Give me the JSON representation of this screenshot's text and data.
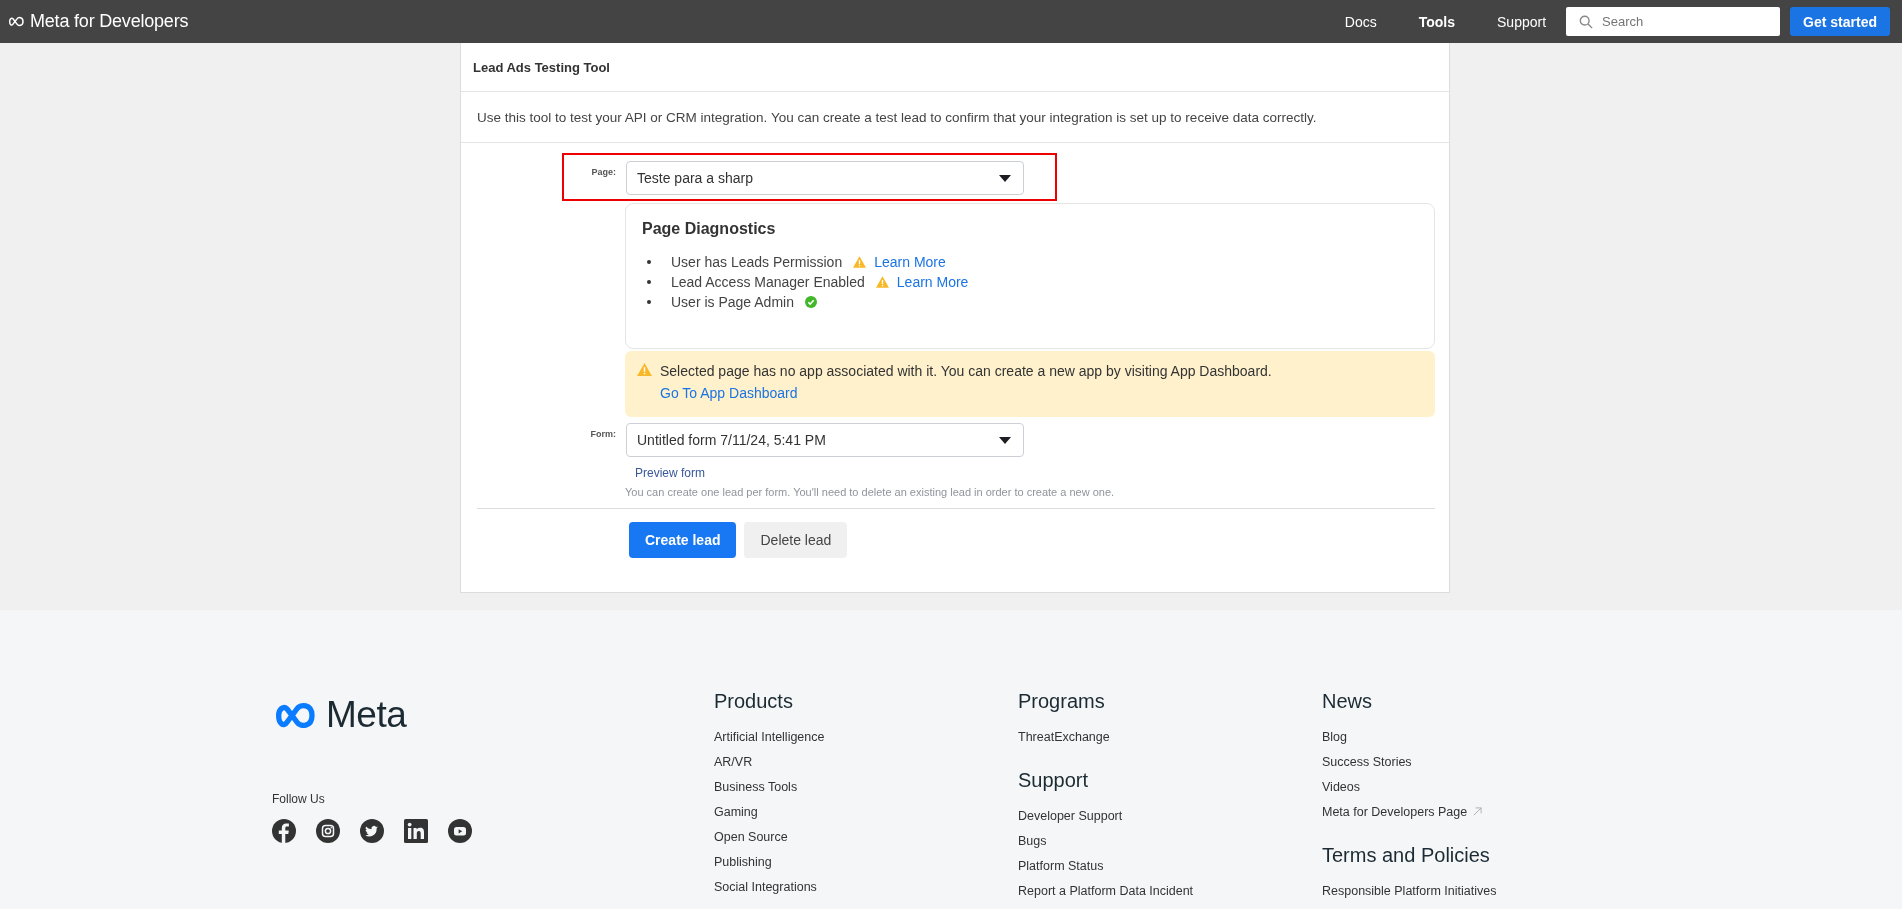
{
  "nav": {
    "brand": "Meta for Developers",
    "links": [
      {
        "label": "Docs",
        "selected": false
      },
      {
        "label": "Tools",
        "selected": true
      },
      {
        "label": "Support",
        "selected": false
      }
    ],
    "search": {
      "placeholder": "Search"
    },
    "cta": "Get started"
  },
  "card": {
    "title": "Lead Ads Testing Tool",
    "description": "Use this tool to test your API or CRM integration. You can create a test lead to confirm that your integration is set up to receive data correctly.",
    "page_field": {
      "label": "Page:",
      "value": "Teste para a sharp",
      "highlighted": true
    },
    "diagnostics": {
      "title": "Page Diagnostics",
      "items": [
        {
          "text": "User has Leads Permission",
          "kind": "warning",
          "link": "Learn More"
        },
        {
          "text": "Lead Access Manager Enabled",
          "kind": "warning",
          "link": "Learn More"
        },
        {
          "text": "User is Page Admin",
          "kind": "ok"
        }
      ]
    },
    "alert": {
      "text": "Selected page has no app associated with it. You can create a new app by visiting App Dashboard.",
      "link": "Go To App Dashboard"
    },
    "form_field": {
      "label": "Form:",
      "value": "Untitled form 7/11/24, 5:41 PM",
      "link": "Preview form",
      "note": "You can create one lead per form. You'll need to delete an existing lead in order to create a new one."
    },
    "buttons": [
      {
        "label": "Create lead",
        "kind": "primary"
      },
      {
        "label": "Delete lead",
        "kind": "secondary"
      }
    ]
  },
  "footer": {
    "logo": "Meta",
    "follow": "Follow Us",
    "social": [
      {
        "kind": "facebook"
      },
      {
        "kind": "instagram"
      },
      {
        "kind": "twitter"
      },
      {
        "kind": "linkedin"
      },
      {
        "kind": "youtube"
      }
    ],
    "columns": [
      [
        {
          "heading": "Products",
          "items": [
            {
              "label": "Artificial Intelligence",
              "external": false
            },
            {
              "label": "AR/VR",
              "external": false
            },
            {
              "label": "Business Tools",
              "external": false
            },
            {
              "label": "Gaming",
              "external": false
            },
            {
              "label": "Open Source",
              "external": false
            },
            {
              "label": "Publishing",
              "external": false
            },
            {
              "label": "Social Integrations",
              "external": false
            }
          ]
        }
      ],
      [
        {
          "heading": "Programs",
          "items": [
            {
              "label": "ThreatExchange",
              "external": false
            }
          ]
        },
        {
          "heading": "Support",
          "items": [
            {
              "label": "Developer Support",
              "external": false
            },
            {
              "label": "Bugs",
              "external": false
            },
            {
              "label": "Platform Status",
              "external": false
            },
            {
              "label": "Report a Platform Data Incident",
              "external": false
            }
          ]
        }
      ],
      [
        {
          "heading": "News",
          "items": [
            {
              "label": "Blog",
              "external": false
            },
            {
              "label": "Success Stories",
              "external": false
            },
            {
              "label": "Videos",
              "external": false
            },
            {
              "label": "Meta for Developers Page",
              "external": true
            }
          ]
        },
        {
          "heading": "Terms and Policies",
          "items": [
            {
              "label": "Responsible Platform Initiatives",
              "external": false
            }
          ]
        }
      ]
    ]
  }
}
